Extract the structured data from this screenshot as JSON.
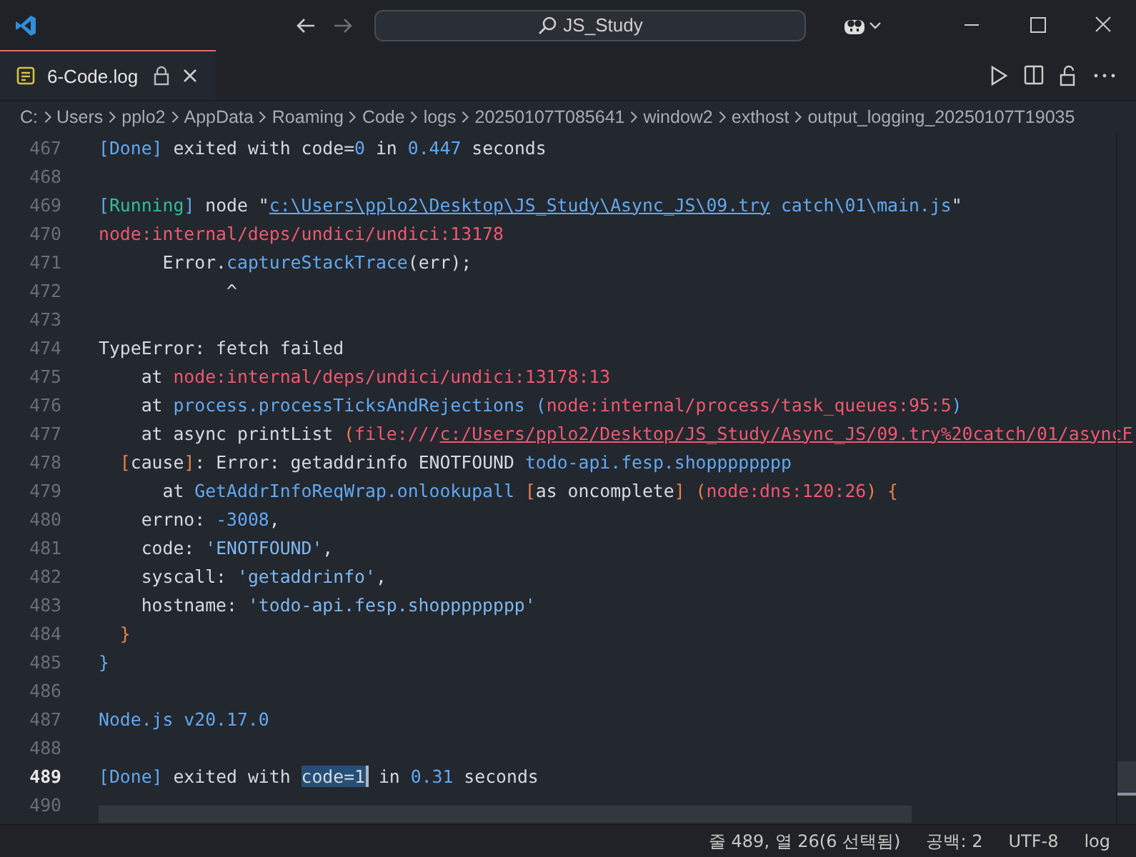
{
  "title_bar": {
    "back": {
      "disabled": false
    },
    "forward": {
      "disabled": true
    },
    "search": "JS_Study"
  },
  "tab": {
    "label": "6-Code.log",
    "locked": true
  },
  "breadcrumbs": [
    "C:",
    "Users",
    "pplo2",
    "AppData",
    "Roaming",
    "Code",
    "logs",
    "20250107T085641",
    "window2",
    "exthost",
    "output_logging_20250107T19035"
  ],
  "lines": [
    {
      "number": "467",
      "current": false,
      "segments": [
        {
          "kind": "blue",
          "text": "[Done]"
        },
        {
          "kind": "plain",
          "text": " exited with code="
        },
        {
          "kind": "blue",
          "text": "0"
        },
        {
          "kind": "plain",
          "text": " in "
        },
        {
          "kind": "blue",
          "text": "0.447"
        },
        {
          "kind": "plain",
          "text": " seconds"
        }
      ]
    },
    {
      "number": "468",
      "current": false
    },
    {
      "number": "469",
      "current": false,
      "segments": [
        {
          "kind": "blue",
          "text": "["
        },
        {
          "kind": "green",
          "text": "Running"
        },
        {
          "kind": "blue",
          "text": "]"
        },
        {
          "kind": "plain",
          "text": " node \""
        },
        {
          "kind": "link",
          "text": "c:\\Users\\pplo2\\Desktop\\JS_Study\\Async_JS\\09.try"
        },
        {
          "kind": "blue",
          "text": " catch\\01\\main.js"
        },
        {
          "kind": "plain",
          "text": "\""
        }
      ]
    },
    {
      "number": "470",
      "current": false,
      "segments": [
        {
          "kind": "red",
          "text": "node:internal/deps/undici/undici:13178"
        }
      ]
    },
    {
      "number": "471",
      "current": false,
      "segments": [
        {
          "kind": "plain",
          "text": "      Error."
        },
        {
          "kind": "blue",
          "text": "captureStackTrace"
        },
        {
          "kind": "plain",
          "text": "(err);"
        }
      ]
    },
    {
      "number": "472",
      "current": false,
      "segments": [
        {
          "kind": "plain",
          "text": "            ^"
        }
      ]
    },
    {
      "number": "473",
      "current": false
    },
    {
      "number": "474",
      "current": false,
      "segments": [
        {
          "kind": "plain",
          "text": "TypeError: fetch failed"
        }
      ]
    },
    {
      "number": "475",
      "current": false,
      "segments": [
        {
          "kind": "plain",
          "text": "    at "
        },
        {
          "kind": "red",
          "text": "node:internal/deps/undici/undici:13178:13"
        }
      ]
    },
    {
      "number": "476",
      "current": false,
      "segments": [
        {
          "kind": "plain",
          "text": "    at "
        },
        {
          "kind": "blue",
          "text": "process.processTicksAndRejections ("
        },
        {
          "kind": "red",
          "text": "node:internal/process/task_queues:95:5"
        },
        {
          "kind": "blue",
          "text": ")"
        }
      ]
    },
    {
      "number": "477",
      "current": false,
      "segments": [
        {
          "kind": "plain",
          "text": "    at async printList "
        },
        {
          "kind": "orange",
          "text": "("
        },
        {
          "kind": "red",
          "text": "file:///"
        },
        {
          "kind": "redlink",
          "text": "c:/Users/pplo2/Desktop/JS_Study/Async_JS/09.try%20catch/01/asyncF"
        }
      ]
    },
    {
      "number": "478",
      "current": false,
      "segments": [
        {
          "kind": "orange",
          "text": "  ["
        },
        {
          "kind": "plain",
          "text": "cause"
        },
        {
          "kind": "orange",
          "text": "]"
        },
        {
          "kind": "plain",
          "text": ": Error: getaddrinfo ENOTFOUND "
        },
        {
          "kind": "blue",
          "text": "todo-api.fesp.shopppppppp"
        }
      ]
    },
    {
      "number": "479",
      "current": false,
      "segments": [
        {
          "kind": "plain",
          "text": "      at "
        },
        {
          "kind": "blue",
          "text": "GetAddrInfoReqWrap.onlookupall"
        },
        {
          "kind": "orange",
          "text": " ["
        },
        {
          "kind": "plain",
          "text": "as oncomplete"
        },
        {
          "kind": "orange",
          "text": "] ("
        },
        {
          "kind": "red",
          "text": "node:dns:120:26"
        },
        {
          "kind": "orange",
          "text": ") {"
        }
      ]
    },
    {
      "number": "480",
      "current": false,
      "segments": [
        {
          "kind": "plain",
          "text": "    errno: "
        },
        {
          "kind": "blue",
          "text": "-3008"
        },
        {
          "kind": "plain",
          "text": ","
        }
      ]
    },
    {
      "number": "481",
      "current": false,
      "segments": [
        {
          "kind": "plain",
          "text": "    code: "
        },
        {
          "kind": "string",
          "text": "'ENOTFOUND'"
        },
        {
          "kind": "plain",
          "text": ","
        }
      ]
    },
    {
      "number": "482",
      "current": false,
      "segments": [
        {
          "kind": "plain",
          "text": "    syscall: "
        },
        {
          "kind": "string",
          "text": "'getaddrinfo'"
        },
        {
          "kind": "plain",
          "text": ","
        }
      ]
    },
    {
      "number": "483",
      "current": false,
      "segments": [
        {
          "kind": "plain",
          "text": "    hostname: "
        },
        {
          "kind": "string",
          "text": "'todo-api.fesp.shopppppppp'"
        }
      ]
    },
    {
      "number": "484",
      "current": false,
      "segments": [
        {
          "kind": "orange",
          "text": "  }"
        }
      ]
    },
    {
      "number": "485",
      "current": false,
      "segments": [
        {
          "kind": "blue",
          "text": "}"
        }
      ]
    },
    {
      "number": "486",
      "current": false
    },
    {
      "number": "487",
      "current": false,
      "segments": [
        {
          "kind": "blue",
          "text": "Node.js v20.17.0"
        }
      ]
    },
    {
      "number": "488",
      "current": false
    },
    {
      "number": "489",
      "current": true,
      "segments": [
        {
          "kind": "blue",
          "text": "[Done]"
        },
        {
          "kind": "plain",
          "text": " exited with "
        },
        {
          "kind": "selection",
          "text": "code=1"
        },
        {
          "kind": "plain",
          "text": " in "
        },
        {
          "kind": "blue",
          "text": "0.31"
        },
        {
          "kind": "plain",
          "text": " seconds"
        }
      ]
    },
    {
      "number": "490",
      "current": false
    }
  ],
  "status_bar": [
    "줄 489, 열 26(6 선택됨)",
    "공백: 2",
    "UTF-8",
    "log"
  ]
}
